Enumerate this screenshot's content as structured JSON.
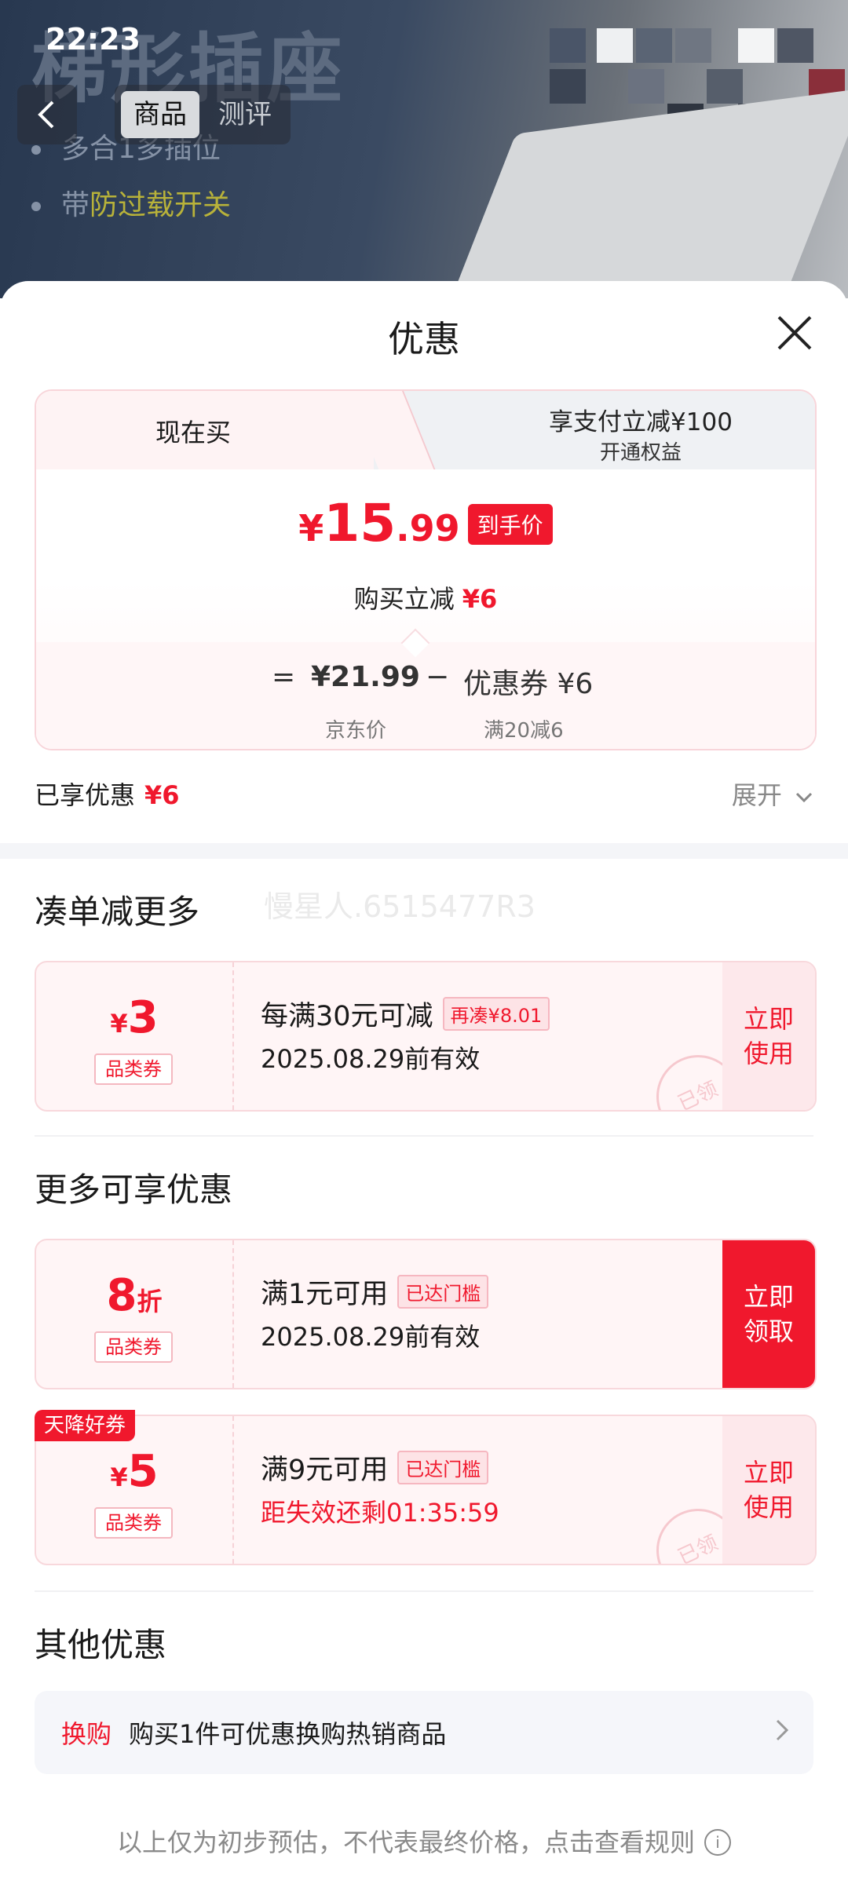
{
  "status_bar": {
    "time": "22:23"
  },
  "hero": {
    "title": "梯形插座",
    "line1": "多合1多插位",
    "line2_prefix": "带",
    "line2_highlight": "防过载开关"
  },
  "nav": {
    "tab_product": "商品",
    "tab_review": "测评"
  },
  "sheet": {
    "title": "优惠",
    "tabs": {
      "now": "现在买",
      "pay_title": "享支付立减¥100",
      "pay_sub": "开通权益"
    },
    "price": {
      "yen": "¥",
      "integer": "15",
      "decimal": ".99",
      "tag": "到手价",
      "reduce_label": "购买立减",
      "reduce_value": "¥6"
    },
    "formula": {
      "eq": "=",
      "jd_price": "¥21.99",
      "minus": "−",
      "coupon": "优惠券 ¥6",
      "jd_label": "京东价",
      "coupon_rule": "满20减6"
    },
    "enjoyed": {
      "label": "已享优惠",
      "value": "¥6",
      "expand": "展开"
    }
  },
  "section_bundle": {
    "title": "凑单减更多",
    "watermark": "慢星人.6515477R3",
    "coupon": {
      "yen": "¥",
      "amount": "3",
      "type": "品类券",
      "desc": "每满30元可减",
      "badge": "再凑¥8.01",
      "date": "2025.08.29前有效",
      "action": "立即使用",
      "stamp": "已领"
    }
  },
  "section_more": {
    "title": "更多可享优惠",
    "coupons": [
      {
        "amount": "8",
        "unit": "折",
        "type": "品类券",
        "desc": "满1元可用",
        "badge": "已达门槛",
        "date": "2025.08.29前有效",
        "action": "立即领取"
      },
      {
        "tag": "天降好券",
        "yen": "¥",
        "amount": "5",
        "type": "品类券",
        "desc": "满9元可用",
        "badge": "已达门槛",
        "date": "距失效还剩01:35:59",
        "action": "立即使用",
        "stamp": "已领"
      }
    ]
  },
  "section_other": {
    "title": "其他优惠",
    "row": {
      "tag": "换购",
      "text": "购买1件可优惠换购热销商品"
    }
  },
  "footer": {
    "note": "以上仅为初步预估，不代表最终价格，点击查看规则",
    "info_icon": "i"
  },
  "colors": {
    "accent": "#f0182d",
    "coupon_bg": "#fff5f6",
    "band": "#f4f5f8"
  }
}
